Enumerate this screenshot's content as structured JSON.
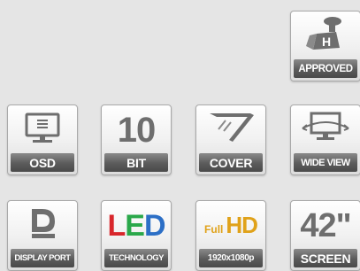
{
  "badges": {
    "approved": {
      "label": "APPROVED"
    },
    "osd": {
      "label": "OSD"
    },
    "bit": {
      "number": "10",
      "label": "BIT"
    },
    "cover": {
      "label": "COVER"
    },
    "wide_view": {
      "label": "WIDE VIEW"
    },
    "display_port": {
      "label": "DISPLAY PORT"
    },
    "led": {
      "letters": [
        "L",
        "E",
        "D"
      ],
      "label": "TECHNOLOGY"
    },
    "full_hd": {
      "full": "Full",
      "hd": "HD",
      "label": "1920x1080p"
    },
    "screen": {
      "size": "42\"",
      "label": "SCREEN"
    }
  },
  "icons": {
    "approved": "vesa-mount-icon",
    "osd": "monitor-icon",
    "cover": "glossy-cover-icon",
    "wide_view": "wide-view-monitor-icon",
    "display_port": "displayport-icon"
  },
  "colors": {
    "background": "#e5e5e5",
    "icon_gray": "#6e6e6e",
    "label_bar": "#5b5b5b",
    "led_l": "#d8262b",
    "led_e": "#2aa84a",
    "led_d": "#2c6fc6",
    "full_hd": "#e0a21a"
  }
}
